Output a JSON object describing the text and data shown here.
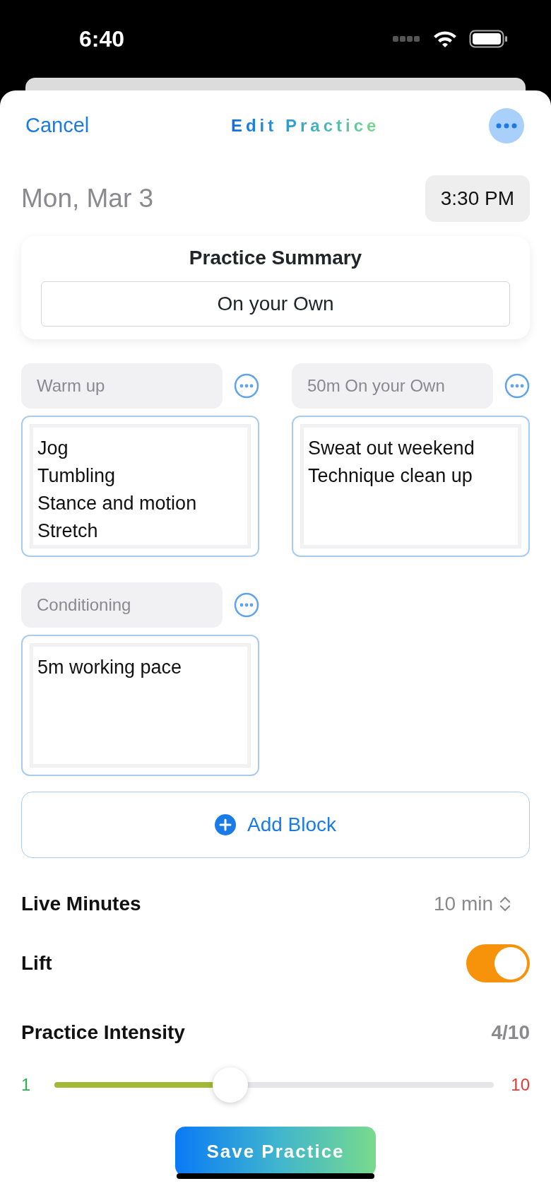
{
  "status_bar": {
    "time": "6:40"
  },
  "nav": {
    "cancel": "Cancel",
    "title": "Edit Practice"
  },
  "date": "Mon, Mar 3",
  "time": "3:30 PM",
  "summary": {
    "title": "Practice Summary",
    "value": "On your Own"
  },
  "blocks": [
    {
      "name": "Warm up",
      "notes": "Jog\nTumbling\nStance and motion\nStretch"
    },
    {
      "name": "50m On your Own",
      "notes": "Sweat out weekend\nTechnique clean up"
    },
    {
      "name": "Conditioning",
      "notes": "5m working pace"
    }
  ],
  "add_block": "Add Block",
  "live_minutes": {
    "label": "Live Minutes",
    "value": "10 min"
  },
  "lift": {
    "label": "Lift",
    "on": true
  },
  "intensity": {
    "label": "Practice Intensity",
    "reading": "4/10",
    "min": "1",
    "max": "10",
    "level": 0.4
  },
  "save": "Save Practice"
}
